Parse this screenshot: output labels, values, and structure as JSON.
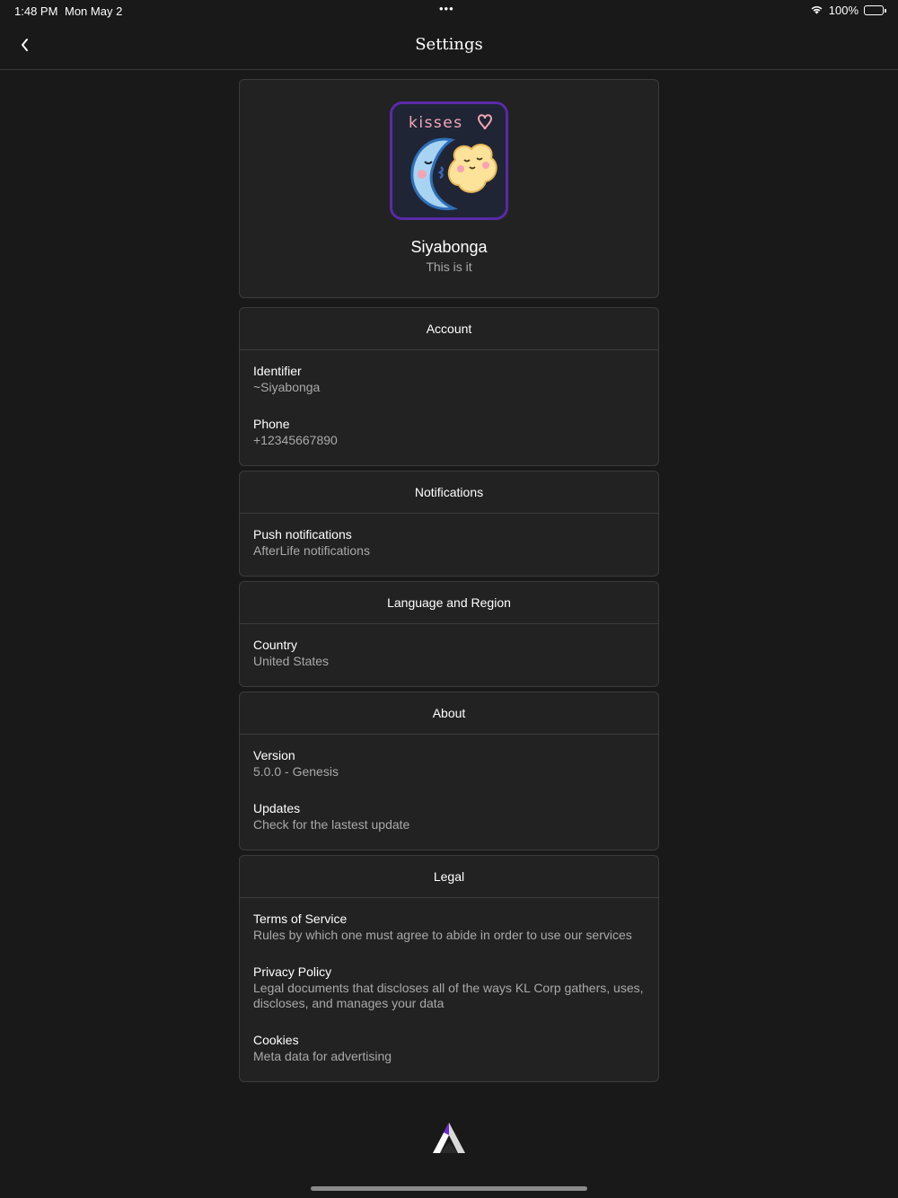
{
  "status_bar": {
    "time": "1:48 PM",
    "date": "Mon May 2",
    "dots": "•••",
    "battery": "100%",
    "battery_level": 1.0
  },
  "nav": {
    "title": "Settings",
    "back_icon": "chevron-left-icon"
  },
  "profile": {
    "avatar_text": "kisses",
    "name": "Siyabonga",
    "status": "This is it"
  },
  "sections": {
    "account": {
      "header": "Account",
      "items": [
        {
          "title": "Identifier",
          "value": "~Siyabonga"
        },
        {
          "title": "Phone",
          "value": "+12345667890"
        }
      ]
    },
    "notifications": {
      "header": "Notifications",
      "items": [
        {
          "title": "Push notifications",
          "value": "AfterLife notifications"
        }
      ]
    },
    "language": {
      "header": "Language and Region",
      "items": [
        {
          "title": "Country",
          "value": "United States"
        }
      ]
    },
    "about": {
      "header": "About",
      "items": [
        {
          "title": "Version",
          "value": "5.0.0 - Genesis"
        },
        {
          "title": "Updates",
          "value": "Check for the lastest update"
        }
      ]
    },
    "legal": {
      "header": "Legal",
      "items": [
        {
          "title": "Terms of Service",
          "value": "Rules by which one must agree to abide in order to use our services"
        },
        {
          "title": "Privacy Policy",
          "value": "Legal documents that discloses all of the ways KL Corp gathers, uses, discloses, and manages your data"
        },
        {
          "title": "Cookies",
          "value": "Meta data for advertising"
        }
      ]
    }
  },
  "colors": {
    "background": "#191919",
    "card": "#222222",
    "border": "#3b3b3b",
    "text_primary": "#ffffff",
    "text_secondary": "#a9a9a9",
    "avatar_border": "#5a2aa8"
  }
}
